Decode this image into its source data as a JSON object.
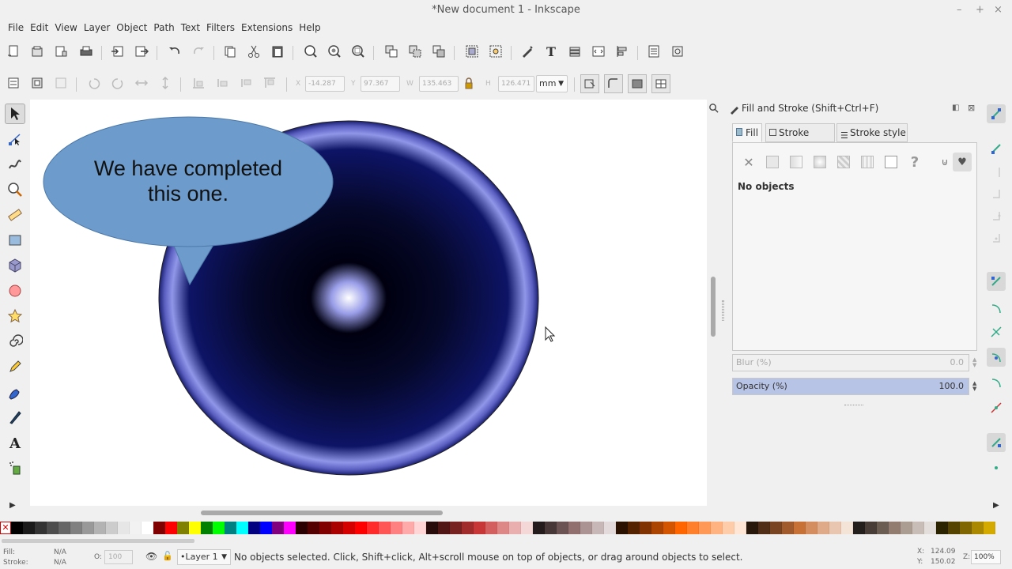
{
  "window": {
    "title": "*New document 1 - Inkscape"
  },
  "menu": [
    "File",
    "Edit",
    "View",
    "Layer",
    "Object",
    "Path",
    "Text",
    "Filters",
    "Extensions",
    "Help"
  ],
  "tool_controls": {
    "x_label": "X",
    "x_value": "-14.287",
    "y_label": "Y",
    "y_value": "97.367",
    "w_label": "W",
    "w_value": "135.463",
    "h_label": "H",
    "h_value": "126.471",
    "unit": "mm"
  },
  "canvas": {
    "speech_bubble_text_line1": "We have completed",
    "speech_bubble_text_line2": "this one.",
    "bubble_color": "#6d9ccc",
    "circle_dark": "#0a0f50",
    "circle_ring": "#8a90e0"
  },
  "dialog": {
    "title": "Fill and Stroke (Shift+Ctrl+F)",
    "tabs": [
      "Fill",
      "Stroke paint",
      "Stroke style"
    ],
    "no_objects": "No objects",
    "blur_label": "Blur (%)",
    "blur_value": "0.0",
    "opacity_label": "Opacity (%)",
    "opacity_value": "100.0"
  },
  "status": {
    "fill_label": "Fill:",
    "fill_value": "N/A",
    "stroke_label": "Stroke:",
    "stroke_value": "N/A",
    "opacity_label": "O:",
    "opacity_value": "100",
    "layer": "•Layer 1",
    "message": "No objects selected. Click, Shift+click, Alt+scroll mouse on top of objects, or drag around objects to select.",
    "x_label": "X:",
    "x_value": "124.09",
    "y_label": "Y:",
    "y_value": "150.02",
    "zoom_label": "Z:",
    "zoom_value": "100%"
  },
  "palette": [
    "#000000",
    "#1a1a1a",
    "#333333",
    "#4d4d4d",
    "#666666",
    "#808080",
    "#999999",
    "#b3b3b3",
    "#cccccc",
    "#e6e6e6",
    "#f2f2f2",
    "#ffffff",
    "#800000",
    "#ff0000",
    "#808000",
    "#ffff00",
    "#008000",
    "#00ff00",
    "#008080",
    "#00ffff",
    "#000080",
    "#0000ff",
    "#800080",
    "#ff00ff",
    "#2b0000",
    "#550000",
    "#800000",
    "#aa0000",
    "#d40000",
    "#ff0000",
    "#ff2a2a",
    "#ff5555",
    "#ff8080",
    "#ffaaaa",
    "#ffd5d5",
    "#280b0b",
    "#501616",
    "#782121",
    "#a02c2c",
    "#c83737",
    "#d35f5f",
    "#de8787",
    "#e9afaf",
    "#f4d7d7",
    "#241c1c",
    "#483737",
    "#6c5353",
    "#916f6f",
    "#ac9393",
    "#c8b7b7",
    "#e3dbdb",
    "#2b1100",
    "#552200",
    "#803300",
    "#aa4400",
    "#d45500",
    "#ff6600",
    "#ff7f2a",
    "#ff9955",
    "#ffb380",
    "#ffccaa",
    "#ffe6d5",
    "#28170b",
    "#502d16",
    "#784421",
    "#a05a2c",
    "#c87137",
    "#d38d5f",
    "#deaa87",
    "#e9c6af",
    "#f4e3d7",
    "#241f1c",
    "#483e37",
    "#6c5d53",
    "#917c6f",
    "#ac9d93",
    "#c8beb7",
    "#e3dedb",
    "#2b2200",
    "#554400",
    "#806600",
    "#aa8800",
    "#d4aa00"
  ]
}
